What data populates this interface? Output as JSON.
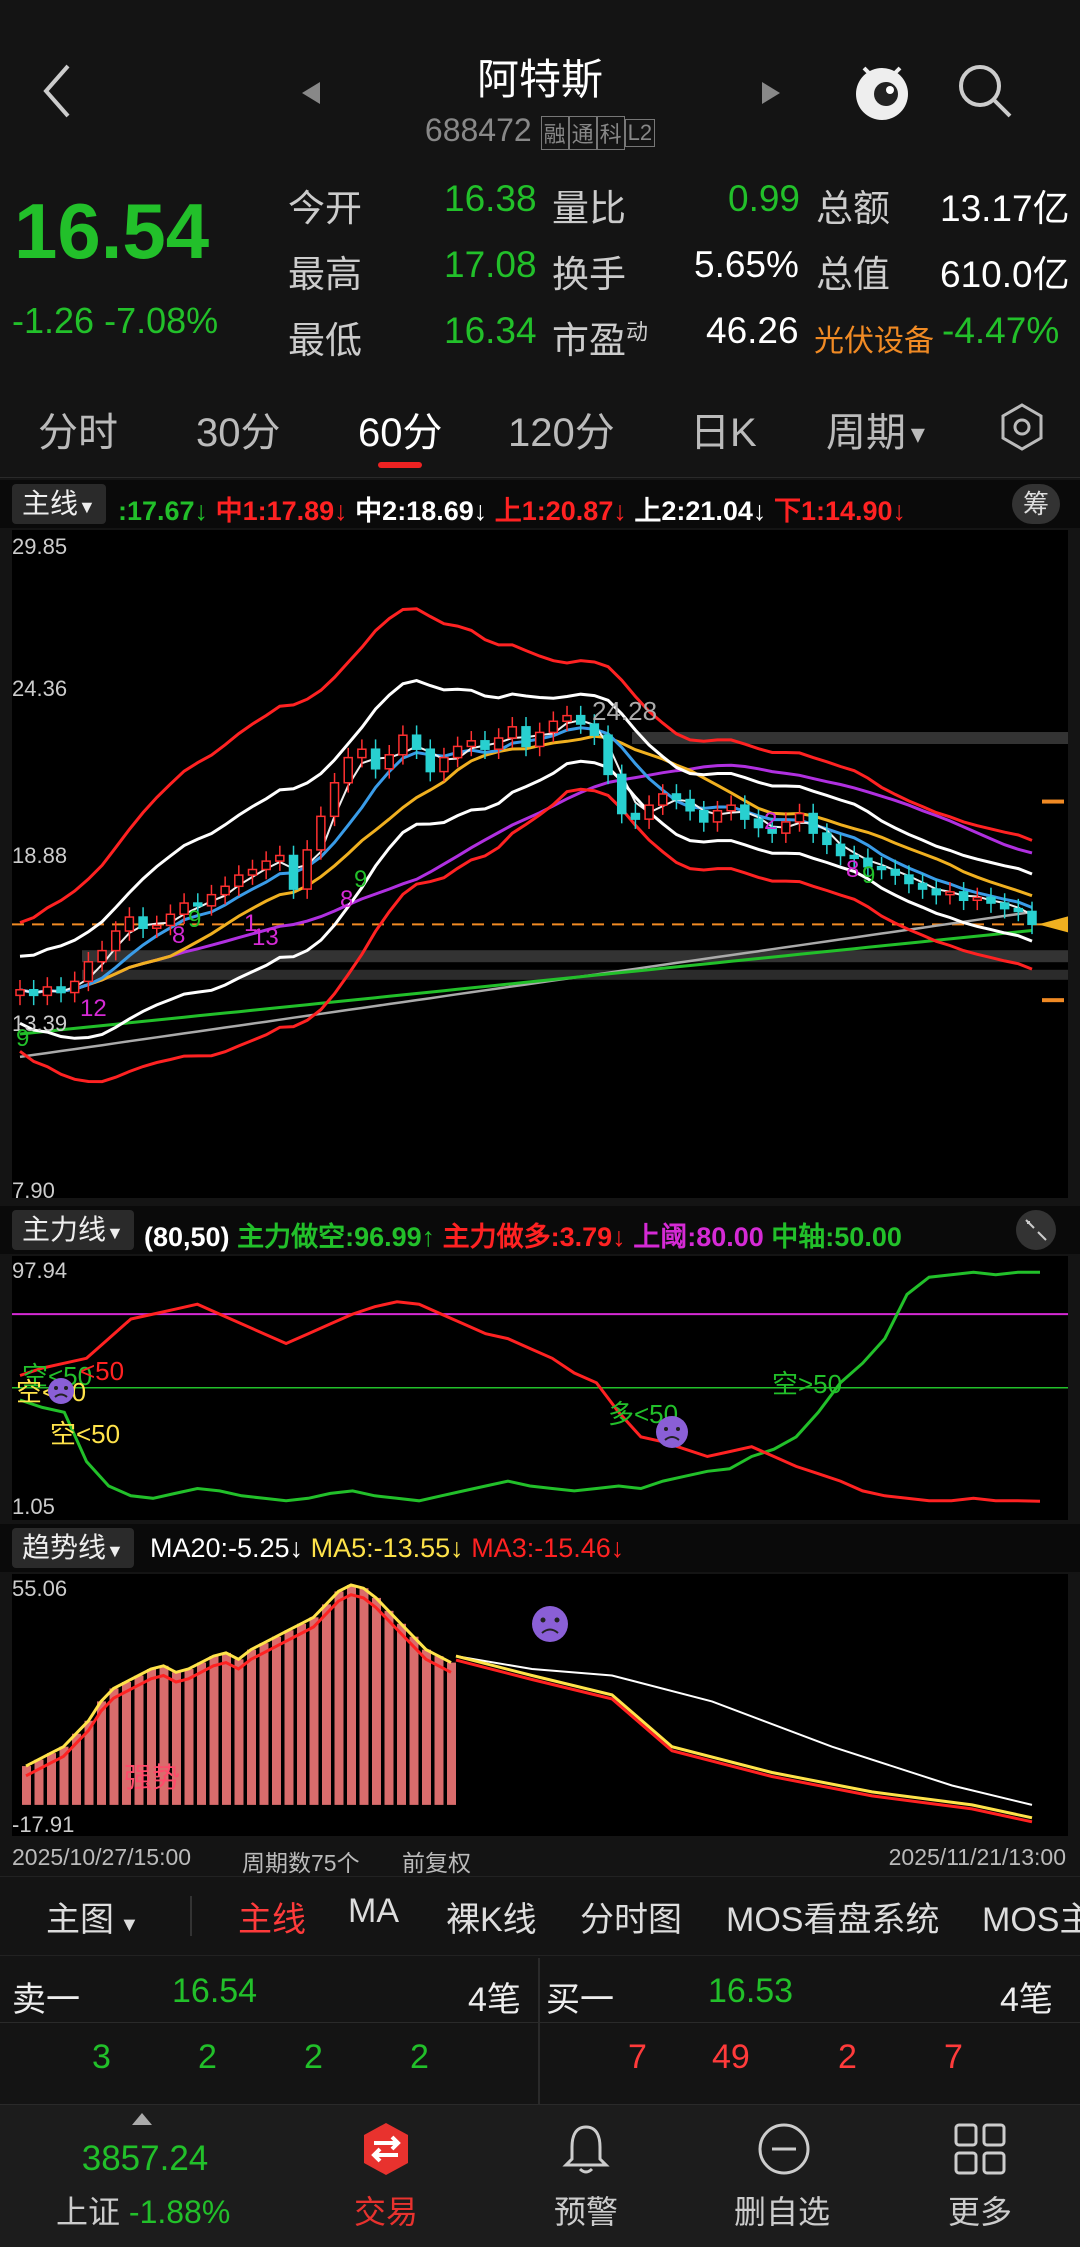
{
  "header": {
    "title": "阿特斯",
    "code": "688472",
    "badges": [
      "融",
      "通",
      "科",
      "L2"
    ]
  },
  "quote": {
    "price": "16.54",
    "change": "-1.26",
    "change_pct": "-7.08%",
    "rows": [
      {
        "l1": "今开",
        "v1": "16.38",
        "l2": "量比",
        "v2": "0.99",
        "l3": "总额",
        "v3": "13.17亿"
      },
      {
        "l1": "最高",
        "v1": "17.08",
        "l2": "换手",
        "v2": "5.65%",
        "l3": "总值",
        "v3": "610.0亿"
      },
      {
        "l1": "最低",
        "v1": "16.34",
        "l2": "市盈",
        "l2sup": "动",
        "v2": "46.26",
        "l3": "光伏设备",
        "v3": "-4.47%"
      }
    ]
  },
  "tabs": [
    "分时",
    "30分",
    "60分",
    "120分",
    "日K",
    "周期"
  ],
  "main_panel": {
    "tag": "主线",
    "legend": [
      {
        "text": ":17.67↓",
        "color": "#22c02a"
      },
      {
        "text": "中1:17.89↓",
        "color": "#ff2222"
      },
      {
        "text": "中2:18.69↓",
        "color": "#ffffff"
      },
      {
        "text": "上1:20.87↓",
        "color": "#ff2222"
      },
      {
        "text": "上2:21.04↓",
        "color": "#ffffff"
      },
      {
        "text": "下1:14.90↓",
        "color": "#ff2222"
      }
    ],
    "chip_btn": "筹",
    "y_labels": [
      "29.85",
      "24.36",
      "18.88",
      "13.39",
      "7.90"
    ],
    "annotation_high": "24.28",
    "markers": [
      "9",
      "12",
      "9",
      "8",
      "1",
      "13",
      "8",
      "9",
      "2",
      "8",
      "9"
    ]
  },
  "power_panel": {
    "tag": "主力线",
    "params": "(80,50)",
    "legend": [
      {
        "text": "主力做空:96.99↑",
        "color": "#22c02a"
      },
      {
        "text": "主力做多:3.79↓",
        "color": "#ff2222"
      },
      {
        "text": "上阈:80.00",
        "color": "#d52ad5"
      },
      {
        "text": "中轴:50.00",
        "color": "#22c02a"
      }
    ],
    "y_labels": [
      "97.94",
      "1.05"
    ],
    "annotations": [
      "空<50",
      "<50",
      "空<50",
      "空<50",
      "多<50",
      "空>50"
    ]
  },
  "trend_panel": {
    "tag": "趋势线",
    "legend": [
      {
        "text": "MA20:-5.25↓",
        "color": "#ffffff"
      },
      {
        "text": "MA5:-13.55↓",
        "color": "#ffe34a"
      },
      {
        "text": "MA3:-15.46↓",
        "color": "#ff2222"
      }
    ],
    "y_labels": [
      "55.06",
      "-17.91"
    ],
    "strong_label": "强势"
  },
  "footer_info": {
    "start": "2025/10/27/15:00",
    "count": "周期数75个",
    "adjust": "前复权",
    "end": "2025/11/21/13:00"
  },
  "sub_tabs": {
    "main_label": "主图",
    "items": [
      "主线",
      "MA",
      "裸K线",
      "分时图",
      "MOS看盘系统",
      "MOS主"
    ]
  },
  "orderbook": {
    "sell": {
      "label": "卖一",
      "price": "16.54",
      "count": "4笔",
      "vols": [
        "3",
        "2",
        "2",
        "2"
      ]
    },
    "buy": {
      "label": "买一",
      "price": "16.53",
      "count": "4笔",
      "vols": [
        "7",
        "49",
        "2",
        "7"
      ]
    }
  },
  "bottom_nav": {
    "index_value": "3857.24",
    "index_name": "上证",
    "index_change": "-1.88%",
    "items": [
      "交易",
      "预警",
      "删自选",
      "更多"
    ]
  },
  "chart_data": [
    {
      "type": "candlestick",
      "title": "",
      "ylim": [
        7.9,
        29.85
      ],
      "y_ticks": [
        29.85,
        24.36,
        18.88,
        13.39,
        7.9
      ],
      "close_series": [
        14.2,
        14.0,
        14.3,
        14.1,
        14.5,
        15.2,
        15.6,
        16.3,
        16.8,
        16.4,
        16.5,
        16.9,
        17.3,
        17.2,
        17.6,
        17.9,
        18.3,
        18.5,
        18.8,
        19.0,
        17.8,
        19.2,
        20.4,
        21.6,
        22.5,
        22.8,
        22.1,
        22.6,
        23.3,
        22.8,
        22.0,
        22.5,
        22.9,
        23.1,
        22.8,
        23.2,
        23.6,
        22.9,
        23.4,
        23.8,
        24.0,
        23.7,
        23.3,
        21.9,
        20.5,
        20.3,
        20.8,
        21.2,
        21.0,
        20.6,
        20.2,
        20.6,
        20.8,
        20.3,
        20.0,
        19.8,
        20.2,
        20.5,
        19.8,
        19.4,
        19.0,
        18.9,
        18.6,
        18.5,
        18.3,
        18.0,
        17.8,
        17.6,
        17.7,
        17.4,
        17.5,
        17.3,
        17.1,
        17.0,
        16.54
      ]
    },
    {
      "type": "line",
      "title": "",
      "ylim": [
        1.05,
        97.94
      ],
      "series": [
        {
          "name": "主力做空",
          "values": [
            45,
            42,
            40,
            20,
            10,
            6,
            5,
            7,
            9,
            8,
            6,
            5,
            4,
            5,
            7,
            8,
            6,
            5,
            4,
            6,
            8,
            10,
            12,
            10,
            9,
            8,
            9,
            10,
            9,
            12,
            14,
            16,
            17,
            22,
            25,
            30,
            40,
            52,
            60,
            70,
            88,
            95,
            96,
            97,
            96,
            97,
            96.99
          ]
        },
        {
          "name": "主力做多",
          "values": [
            55,
            58,
            60,
            62,
            70,
            78,
            80,
            82,
            84,
            80,
            76,
            72,
            68,
            72,
            76,
            80,
            83,
            85,
            84,
            80,
            76,
            72,
            70,
            66,
            62,
            56,
            52,
            40,
            30,
            28,
            25,
            22,
            24,
            26,
            22,
            18,
            15,
            12,
            8,
            6,
            5,
            4,
            4,
            5,
            4,
            4,
            3.79
          ]
        }
      ]
    },
    {
      "type": "bar",
      "title": "",
      "ylim": [
        -17.91,
        55.06
      ],
      "series": [
        {
          "name": "MA20",
          "values": [
            -5.25
          ]
        },
        {
          "name": "MA5",
          "values": [
            -13.55
          ]
        },
        {
          "name": "MA3",
          "values": [
            -15.46
          ]
        }
      ]
    }
  ]
}
